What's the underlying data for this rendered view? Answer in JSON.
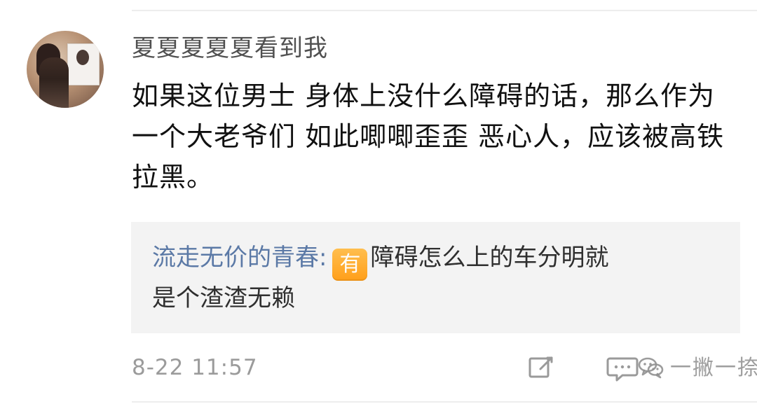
{
  "comment": {
    "username": "夏夏夏夏夏看到我",
    "text": "如果这位男士 身体上没什么障碍的话，那么作为一个大老爷们 如此唧唧歪歪 恶心人，应该被高铁拉黑。",
    "timestamp": "8-22 11:57"
  },
  "reply": {
    "username": "流走无价的青春",
    "colon": ":",
    "badge": "有",
    "text_line_1": "障碍怎么上的车分明就",
    "text_line_2": "是个渣渣无赖"
  },
  "watermark": {
    "text": "一撇一捺"
  },
  "icons": {
    "edit": "edit-icon",
    "comment": "comment-icon",
    "watermark": "wechat-icon"
  },
  "colors": {
    "reply_user": "#5b79a6",
    "badge": "#ff9f1a",
    "reply_background": "#f3f3f3"
  }
}
